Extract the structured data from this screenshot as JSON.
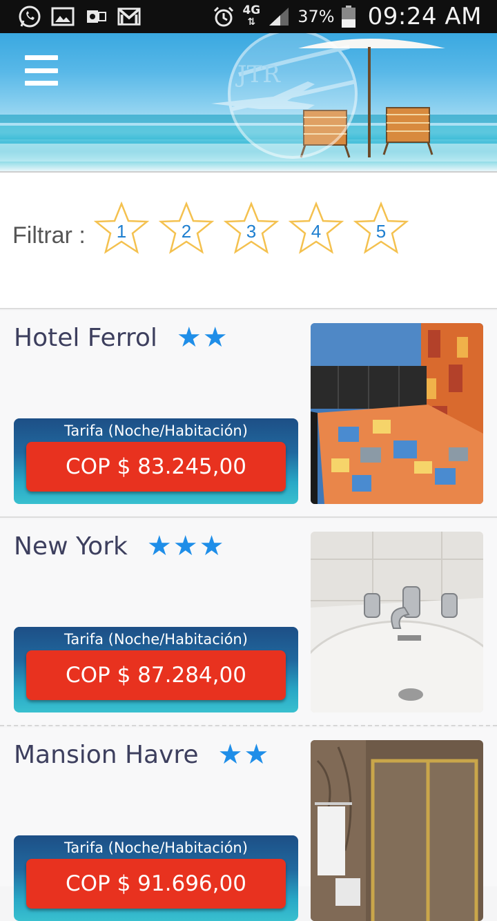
{
  "status_bar": {
    "left_icons": [
      "whatsapp-icon",
      "gallery-icon",
      "outlook-icon",
      "gmail-icon"
    ],
    "right_icons": [
      "alarm-icon",
      "network-4g-icon",
      "signal-icon",
      "battery-icon"
    ],
    "network": "4G",
    "battery": "37%",
    "time": "09:24 AM"
  },
  "header": {
    "menu_icon": "hamburger-menu-icon",
    "logo_text": "JTR"
  },
  "filter": {
    "label": "Filtrar :",
    "stars": [
      "1",
      "2",
      "3",
      "4",
      "5"
    ]
  },
  "hotels": [
    {
      "name": "Hotel Ferrol",
      "stars": "★★",
      "tarifa_label": "Tarifa (Noche/Habitación)",
      "price": "COP $ 83.245,00",
      "photo": "hotel-room-bed-photo"
    },
    {
      "name": "New York",
      "stars": "★★★",
      "tarifa_label": "Tarifa (Noche/Habitación)",
      "price": "COP $ 87.284,00",
      "photo": "bathroom-sink-photo"
    },
    {
      "name": "Mansion Havre",
      "stars": "★★",
      "tarifa_label": "Tarifa (Noche/Habitación)",
      "price": "COP $ 91.696,00",
      "photo": "shower-photo"
    }
  ],
  "colors": {
    "price_button": "#e8321f",
    "star_blue": "#1f8ee8",
    "filter_star_outline": "#f4c14f",
    "hotel_name": "#3d3f5e"
  }
}
